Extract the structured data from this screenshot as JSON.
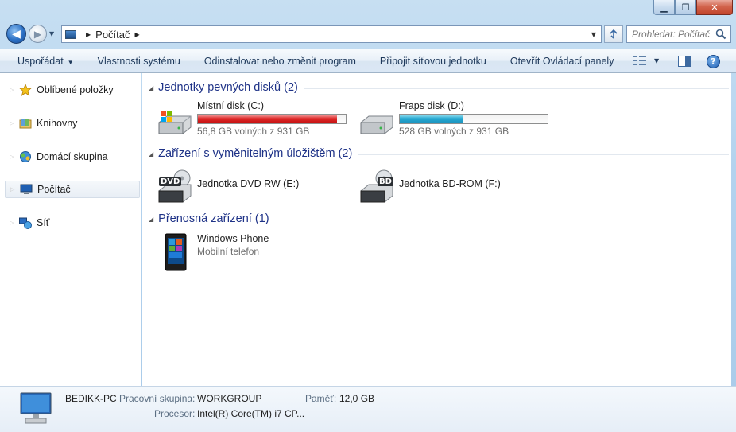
{
  "address": {
    "crumb": "Počítač",
    "refresh_icon": "refresh-icon"
  },
  "search": {
    "placeholder": "Prohledat: Počítač"
  },
  "commandbar": {
    "organize": "Uspořádat",
    "system_properties": "Vlastnosti systému",
    "uninstall": "Odinstalovat nebo změnit program",
    "map_drive": "Připojit síťovou jednotku",
    "control_panel": "Otevřít Ovládací panely",
    "help": "?"
  },
  "navpane": {
    "items": [
      {
        "label": "Oblíbené položky",
        "icon": "star-icon"
      },
      {
        "label": "Knihovny",
        "icon": "libraries-icon"
      },
      {
        "label": "Domácí skupina",
        "icon": "homegroup-icon"
      },
      {
        "label": "Počítač",
        "icon": "computer-icon",
        "selected": true
      },
      {
        "label": "Síť",
        "icon": "network-icon"
      }
    ]
  },
  "groups": {
    "hdd": {
      "title": "Jednotky pevných disků (2)",
      "drives": [
        {
          "name": "Místní disk (C:)",
          "free": "56,8 GB volných z 931 GB",
          "used_fraction": 0.94,
          "bar_color": "#d41b1b"
        },
        {
          "name": "Fraps disk (D:)",
          "free": "528 GB volných z 931 GB",
          "used_fraction": 0.43,
          "bar_color": "#26a7cf"
        }
      ]
    },
    "removable": {
      "title": "Zařízení s vyměnitelným úložištěm (2)",
      "devices": [
        {
          "name": "Jednotka DVD RW (E:)",
          "badge": "DVD"
        },
        {
          "name": "Jednotka BD-ROM (F:)",
          "badge": "BD"
        }
      ]
    },
    "portable": {
      "title": "Přenosná zařízení (1)",
      "devices": [
        {
          "name": "Windows Phone",
          "sub": "Mobilní telefon"
        }
      ]
    }
  },
  "details": {
    "pc_name": "BEDIKK-PC",
    "workgroup_label": "Pracovní skupina:",
    "workgroup_value": "WORKGROUP",
    "memory_label": "Paměť:",
    "memory_value": "12,0 GB",
    "cpu_label": "Procesor:",
    "cpu_value": "Intel(R) Core(TM) i7 CP..."
  }
}
